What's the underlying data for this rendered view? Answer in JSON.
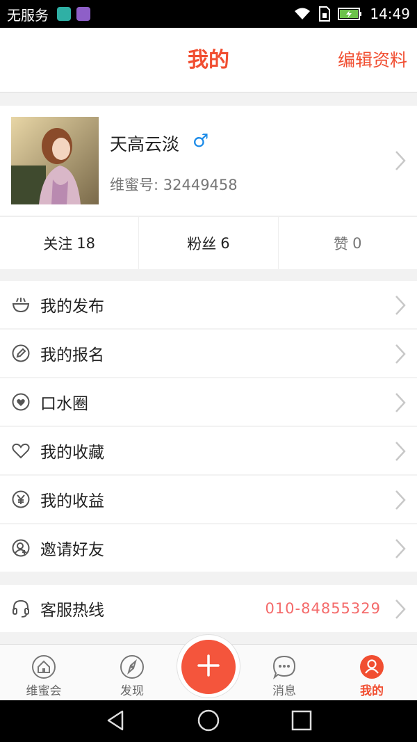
{
  "status_bar": {
    "carrier": "无服务",
    "time": "14:49",
    "icons": [
      "app-notification-icon",
      "gallery-notification-icon",
      "wifi-icon",
      "sim-icon",
      "battery-charging-icon"
    ]
  },
  "header": {
    "title": "我的",
    "edit_label": "编辑资料"
  },
  "profile": {
    "username": "天高云淡",
    "gender_symbol": "♂",
    "member_label": "维蜜号: 32449458"
  },
  "stats": [
    {
      "label": "关注",
      "value": "18"
    },
    {
      "label": "粉丝",
      "value": "6"
    },
    {
      "label": "赞",
      "value": "0"
    }
  ],
  "menu": [
    {
      "label": "我的发布",
      "icon": "bowl-icon"
    },
    {
      "label": "我的报名",
      "icon": "pencil-circle-icon"
    },
    {
      "label": "口水圈",
      "icon": "heart-circle-icon"
    },
    {
      "label": "我的收藏",
      "icon": "heart-outline-icon"
    },
    {
      "label": "我的收益",
      "icon": "yen-circle-icon"
    },
    {
      "label": "邀请好友",
      "icon": "add-person-icon"
    }
  ],
  "service": {
    "label": "客服热线",
    "phone": "010-84855329",
    "icon": "headset-icon"
  },
  "bottom_nav": [
    {
      "label": "维蜜会",
      "icon": "home-icon",
      "active": false
    },
    {
      "label": "发现",
      "icon": "compass-icon",
      "active": false
    },
    {
      "label": "消息",
      "icon": "chat-bubble-icon",
      "active": false
    },
    {
      "label": "我的",
      "icon": "person-icon",
      "active": true
    }
  ],
  "colors": {
    "accent": "#f14e31",
    "phone_text": "#f46a6a",
    "gender_blue": "#1a8ae8",
    "background": "#f2f2f2"
  }
}
